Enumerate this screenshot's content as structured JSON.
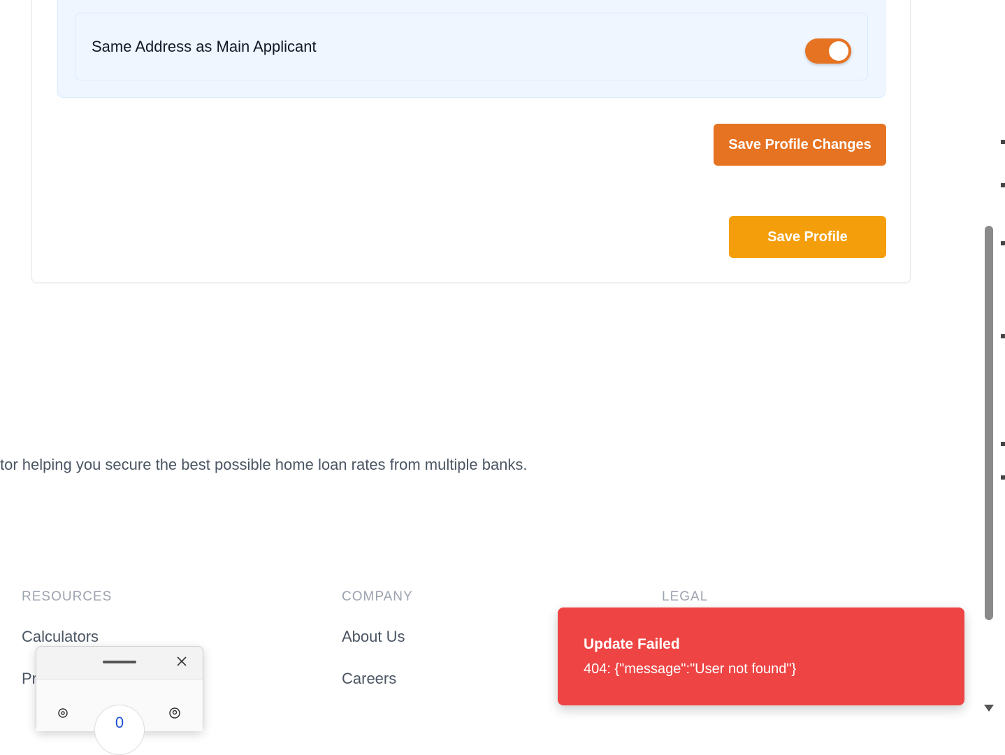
{
  "profile": {
    "toggle_label": "Same Address as Main Applicant",
    "toggle_on": true,
    "save_changes_label": "Save Profile Changes",
    "save_label": "Save Profile"
  },
  "footer": {
    "tagline": "tor helping you secure the best possible home loan rates from multiple banks.",
    "columns": [
      {
        "heading": "RESOURCES",
        "links": [
          "Calculators",
          "Pr"
        ]
      },
      {
        "heading": "COMPANY",
        "links": [
          "About Us",
          "Careers"
        ]
      },
      {
        "heading": "LEGAL",
        "links": []
      }
    ]
  },
  "toast": {
    "title": "Update Failed",
    "message": "404: {\"message\":\"User not found\"}"
  },
  "widget": {
    "center_text": "0"
  },
  "colors": {
    "accent_orange": "#e67322",
    "amber": "#f59e0b",
    "error_red": "#ef4444",
    "section_bg": "#eff6ff"
  }
}
